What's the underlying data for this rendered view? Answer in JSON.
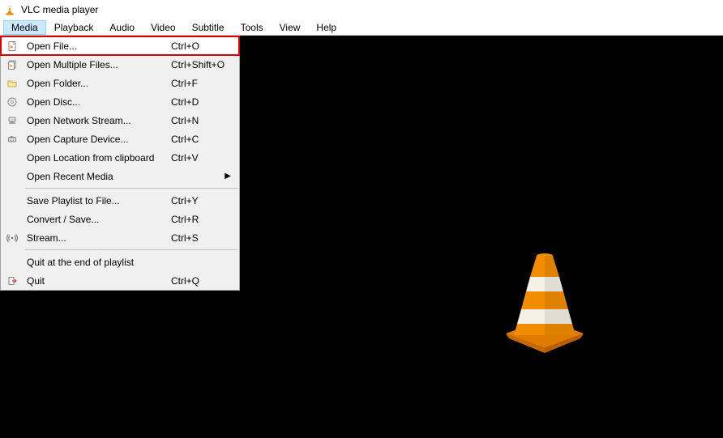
{
  "window": {
    "title": "VLC media player"
  },
  "menubar": {
    "items": [
      {
        "label": "Media",
        "active": true
      },
      {
        "label": "Playback"
      },
      {
        "label": "Audio"
      },
      {
        "label": "Video"
      },
      {
        "label": "Subtitle"
      },
      {
        "label": "Tools"
      },
      {
        "label": "View"
      },
      {
        "label": "Help"
      }
    ]
  },
  "dropdown": {
    "items": [
      {
        "icon": "file-icon",
        "label": "Open File...",
        "shortcut": "Ctrl+O",
        "highlighted": true
      },
      {
        "icon": "files-icon",
        "label": "Open Multiple Files...",
        "shortcut": "Ctrl+Shift+O"
      },
      {
        "icon": "folder-icon",
        "label": "Open Folder...",
        "shortcut": "Ctrl+F"
      },
      {
        "icon": "disc-icon",
        "label": "Open Disc...",
        "shortcut": "Ctrl+D"
      },
      {
        "icon": "network-icon",
        "label": "Open Network Stream...",
        "shortcut": "Ctrl+N"
      },
      {
        "icon": "capture-icon",
        "label": "Open Capture Device...",
        "shortcut": "Ctrl+C"
      },
      {
        "icon": "",
        "label": "Open Location from clipboard",
        "shortcut": "Ctrl+V"
      },
      {
        "icon": "",
        "label": "Open Recent Media",
        "shortcut": "",
        "submenu": true
      },
      {
        "separator": true
      },
      {
        "icon": "",
        "label": "Save Playlist to File...",
        "shortcut": "Ctrl+Y"
      },
      {
        "icon": "",
        "label": "Convert / Save...",
        "shortcut": "Ctrl+R"
      },
      {
        "icon": "stream-icon",
        "label": "Stream...",
        "shortcut": "Ctrl+S"
      },
      {
        "separator": true
      },
      {
        "icon": "",
        "label": "Quit at the end of playlist",
        "shortcut": ""
      },
      {
        "icon": "quit-icon",
        "label": "Quit",
        "shortcut": "Ctrl+Q"
      }
    ]
  }
}
